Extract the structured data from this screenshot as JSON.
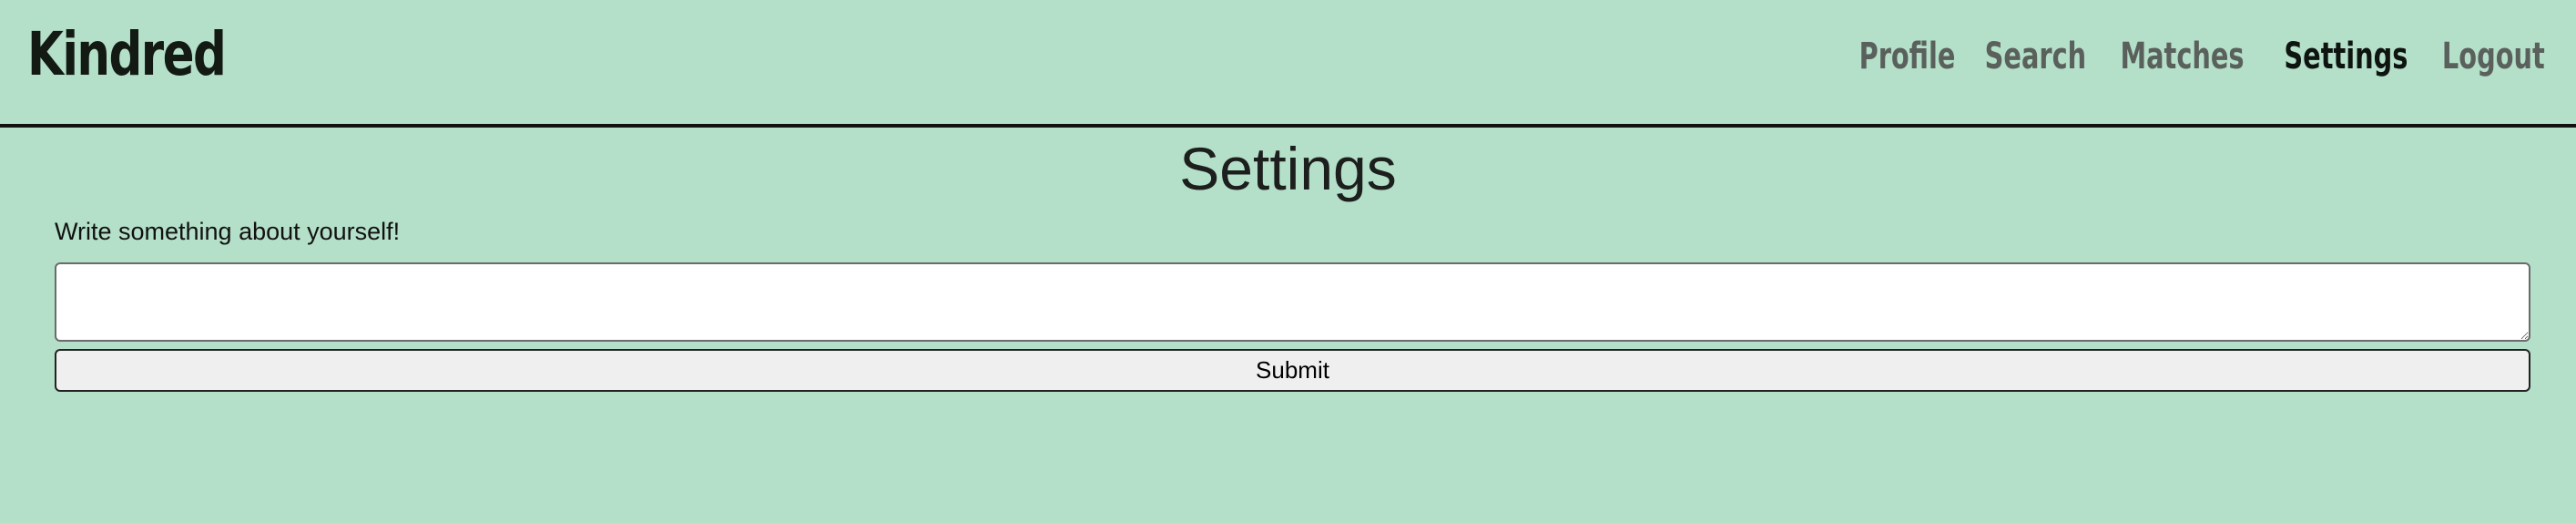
{
  "navbar": {
    "brand": "Kindred",
    "links": [
      {
        "label": "Profile",
        "active": false
      },
      {
        "label": "Search",
        "active": false
      },
      {
        "label": "Matches",
        "active": false
      },
      {
        "label": "Settings",
        "active": true
      },
      {
        "label": "Logout",
        "active": false
      }
    ]
  },
  "page": {
    "title": "Settings",
    "bio_label": "Write something about yourself!",
    "bio_value": "",
    "submit_label": "Submit"
  },
  "colors": {
    "background": "#b4dfc8",
    "nav_link": "#5a615d",
    "nav_link_active": "#0e1410"
  }
}
